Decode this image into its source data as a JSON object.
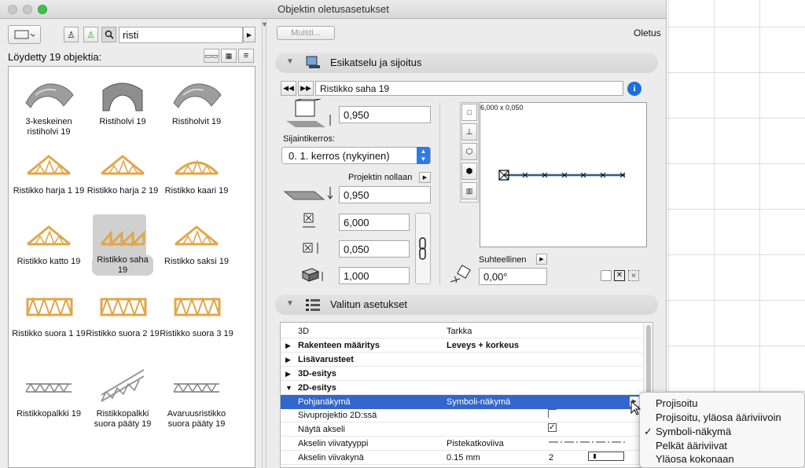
{
  "window": {
    "title": "Objektin oletusasetukset"
  },
  "left": {
    "search_value": "risti",
    "found_count": "Löydetty 19 objektia:",
    "objects": [
      {
        "label": "3-keskeinen ristiholvi 19"
      },
      {
        "label": "Ristiholvi 19"
      },
      {
        "label": "Ristiholvit 19"
      },
      {
        "label": "Ristikko harja 1 19"
      },
      {
        "label": "Ristikko harja 2 19"
      },
      {
        "label": "Ristikko kaari 19"
      },
      {
        "label": "Ristikko katto 19"
      },
      {
        "label": "Ristikko saha 19"
      },
      {
        "label": "Ristikko saksi 19"
      },
      {
        "label": "Ristikko suora 1 19"
      },
      {
        "label": "Ristikko suora 2 19"
      },
      {
        "label": "Ristikko suora 3 19"
      },
      {
        "label": "Ristikkopalkki 19"
      },
      {
        "label": "Ristikkopalkki suora pääty 19"
      },
      {
        "label": "Avaruusristikko suora pääty 19"
      }
    ],
    "selected_index": 7
  },
  "top": {
    "memo_label": "Muisti...",
    "default_label": "Oletus"
  },
  "preview": {
    "section_title": "Esikatselu ja sijoitus",
    "object_name": "Ristikko saha 19",
    "elevation_value": "0,950",
    "home_story_label": "Sijaintikerros:",
    "home_story_value": "0. 1. kerros (nykyinen)",
    "reference_label": "Projektin nollaan",
    "project_zero_value": "0,950",
    "width_value": "6,000",
    "depth_value": "0,050",
    "height_value": "1,000",
    "canvas_size": "6,000 x 0,050",
    "relative_label": "Suhteellinen",
    "angle_value": "0,00°"
  },
  "settings": {
    "section_title": "Valitun asetukset",
    "rows": [
      {
        "name": "3D",
        "value": "Tarkka"
      },
      {
        "name": "Rakenteen määritys",
        "value": "Leveys + korkeus"
      },
      {
        "name": "Lisävarusteet",
        "value": ""
      },
      {
        "name": "3D-esitys",
        "value": ""
      },
      {
        "name": "2D-esitys",
        "value": ""
      },
      {
        "name": "Pohjanäkymä",
        "value": "Symboli-näkymä"
      },
      {
        "name": "Sivuprojektio 2D:ssä",
        "value": ""
      },
      {
        "name": "Näytä akseli",
        "value": ""
      },
      {
        "name": "Akselin viivatyyppi",
        "value": "Pistekatkoviiva"
      },
      {
        "name": "Akselin viivakynä",
        "value": "0.15 mm",
        "extra": "2"
      }
    ]
  },
  "dropdown": {
    "options": [
      {
        "label": "Projisoitu",
        "checked": false
      },
      {
        "label": "Projisoitu, yläosa ääriviivoin",
        "checked": false
      },
      {
        "label": "Symboli-näkymä",
        "checked": true
      },
      {
        "label": "Pelkät ääriviivat",
        "checked": false
      },
      {
        "label": "Yläosa kokonaan",
        "checked": false
      }
    ],
    "check_mark": "✓"
  },
  "colors": {
    "highlight": "#3366cc",
    "wood": "#e0a74a",
    "accent_blue": "#1e6fd9"
  }
}
